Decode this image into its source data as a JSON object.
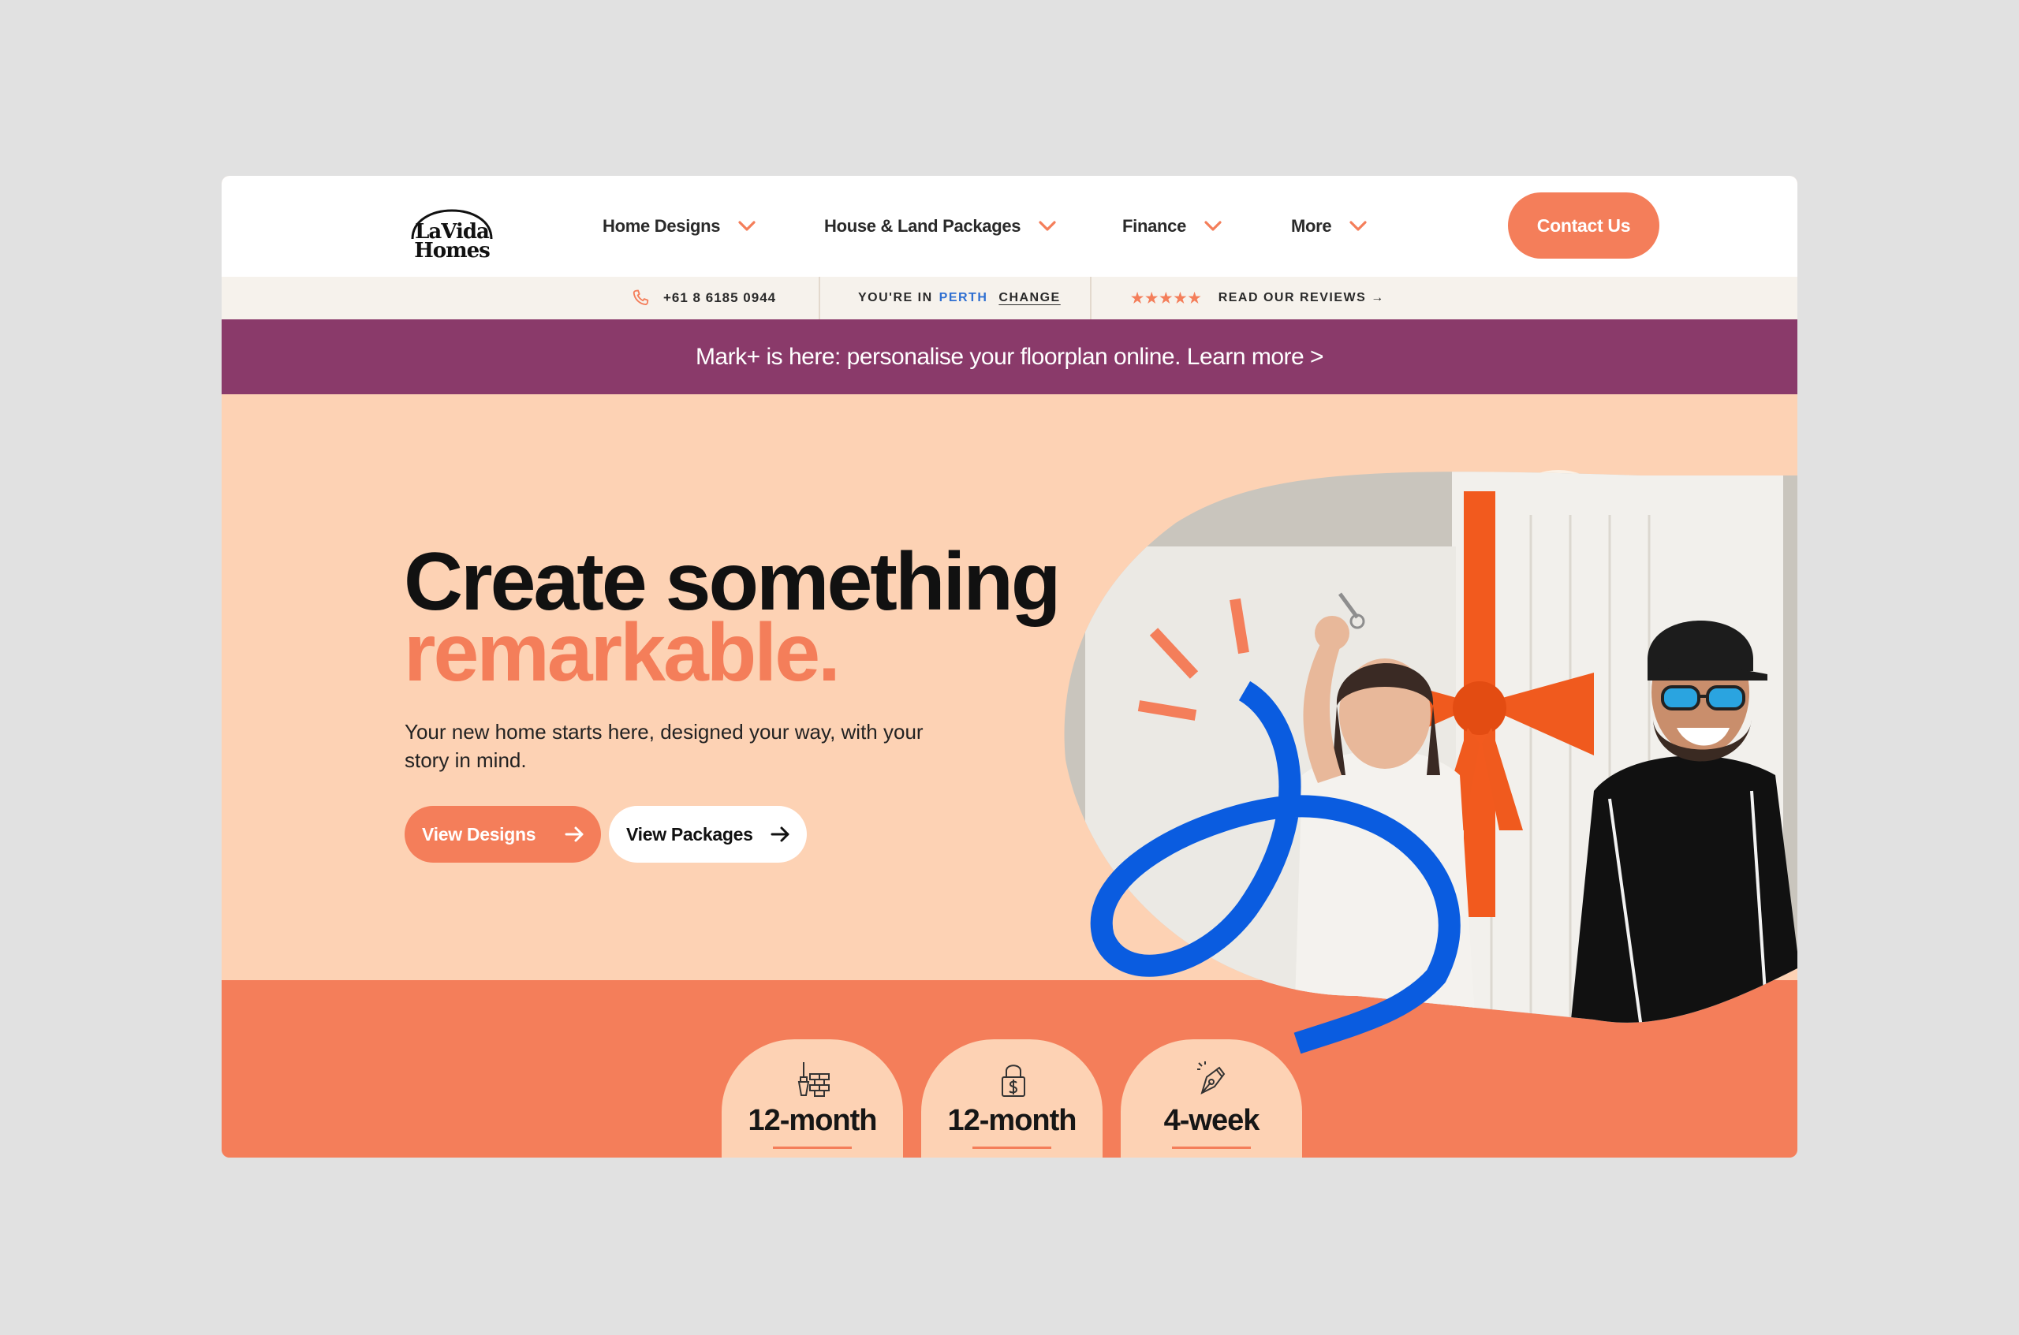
{
  "brand": {
    "logo_line1": "LaVida",
    "logo_line2": "Homes",
    "accent_color": "#f47e5a",
    "banner_color": "#8a3a6a",
    "hero_bg_color": "#fdd2b4",
    "squiggle_color": "#0a5ce0"
  },
  "nav": {
    "items": [
      {
        "label": "Home Designs",
        "icon": "chevron-down-icon"
      },
      {
        "label": "House & Land Packages",
        "icon": "chevron-down-icon"
      },
      {
        "label": "Finance",
        "icon": "chevron-down-icon"
      },
      {
        "label": "More",
        "icon": "chevron-down-icon"
      }
    ],
    "contact_label": "Contact Us"
  },
  "utility": {
    "phone": "+61 8 6185 0944",
    "phone_icon": "phone-icon",
    "location_prefix": "YOU'RE IN",
    "location_city": "PERTH",
    "location_change": "CHANGE",
    "stars": "★★★★★",
    "reviews_label": "READ OUR REVIEWS →"
  },
  "banner": {
    "text": "Mark+ is here: personalise your floorplan online. Learn more >"
  },
  "hero": {
    "title_line1": "Create something",
    "title_line2": "remarkable.",
    "subtitle": "Your new home starts here, designed your way, with your story in mind.",
    "primary_button": "View Designs",
    "secondary_button": "View Packages",
    "arrow_icon": "arrow-right-icon",
    "photo": "couple-holding-house-keys-photo"
  },
  "highlights": [
    {
      "value": "12-month",
      "icon": "bricks-trowel-icon"
    },
    {
      "value": "12-month",
      "icon": "dollar-lock-icon"
    },
    {
      "value": "4-week",
      "icon": "pen-nib-icon"
    }
  ]
}
